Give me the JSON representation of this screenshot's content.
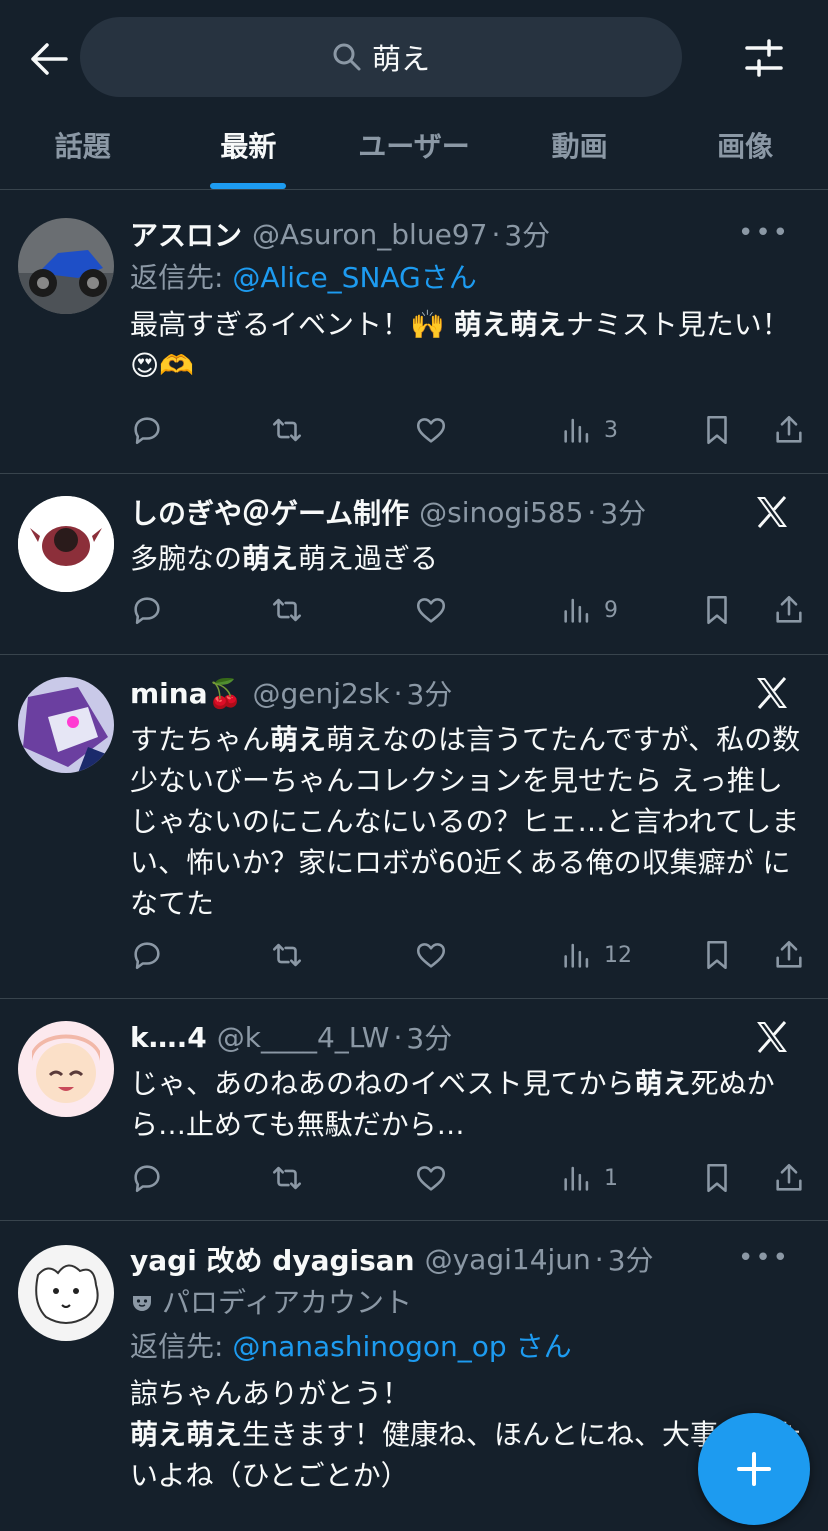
{
  "search": {
    "query": "萌え"
  },
  "tabs": [
    {
      "label": "話題",
      "active": false
    },
    {
      "label": "最新",
      "active": true
    },
    {
      "label": "ユーザー",
      "active": false
    },
    {
      "label": "動画",
      "active": false
    },
    {
      "label": "画像",
      "active": false
    }
  ],
  "tweets": [
    {
      "name": "アスロン",
      "handle": "@Asuron_blue97",
      "time": "3分",
      "reply_prefix": "返信先: ",
      "reply_mention": "@Alice_SNAGさん",
      "text_parts": [
        "最高すぎるイベント！🙌 ",
        "萌え萌え",
        "ナミスト見たい！😍🫶"
      ],
      "views": "3",
      "badge": "more"
    },
    {
      "name": "しのぎや＠ゲーム制作",
      "handle": "@sinogi585",
      "time": "3分",
      "text_parts": [
        "多腕なの",
        "萌え",
        "萌え過ぎる"
      ],
      "views": "9",
      "badge": "x"
    },
    {
      "name": "mina🍒",
      "handle": "@genj2sk",
      "time": "3分",
      "text_parts": [
        "すたちゃん",
        "萌え",
        "萌えなのは言うてたんですが、私の数少ないびーちゃんコレクションを見せたら えっ推しじゃないのにこんなにいるの？ヒェ…と言われてしまい、怖いか？家にロボが60近くある俺の収集癖が になてた"
      ],
      "views": "12",
      "badge": "x"
    },
    {
      "name": "k….4",
      "handle": "@k____4_LW",
      "time": "3分",
      "text_parts": [
        "じゃ、あのねあのねのイベスト見てから",
        "萌え",
        "死ぬから…止めても無駄だから…"
      ],
      "views": "1",
      "badge": "x"
    },
    {
      "name": "yagi 改め dyagisan",
      "handle": "@yagi14jun",
      "time": "3分",
      "parody": "パロディアカウント",
      "reply_prefix": "返信先: ",
      "reply_mention": "@nanashinogon_op さん",
      "text_line1": "諒ちゃんありがとう！",
      "text_parts": [
        "萌え萌え",
        "生きます！健康ね、ほんとにね、大事にしたいよね（ひとごとか）"
      ],
      "views": "",
      "badge": "more"
    }
  ],
  "colors": {
    "background": "#15202b",
    "accent": "#1d9bf0",
    "muted": "#8b98a5",
    "divider": "#38444d"
  }
}
